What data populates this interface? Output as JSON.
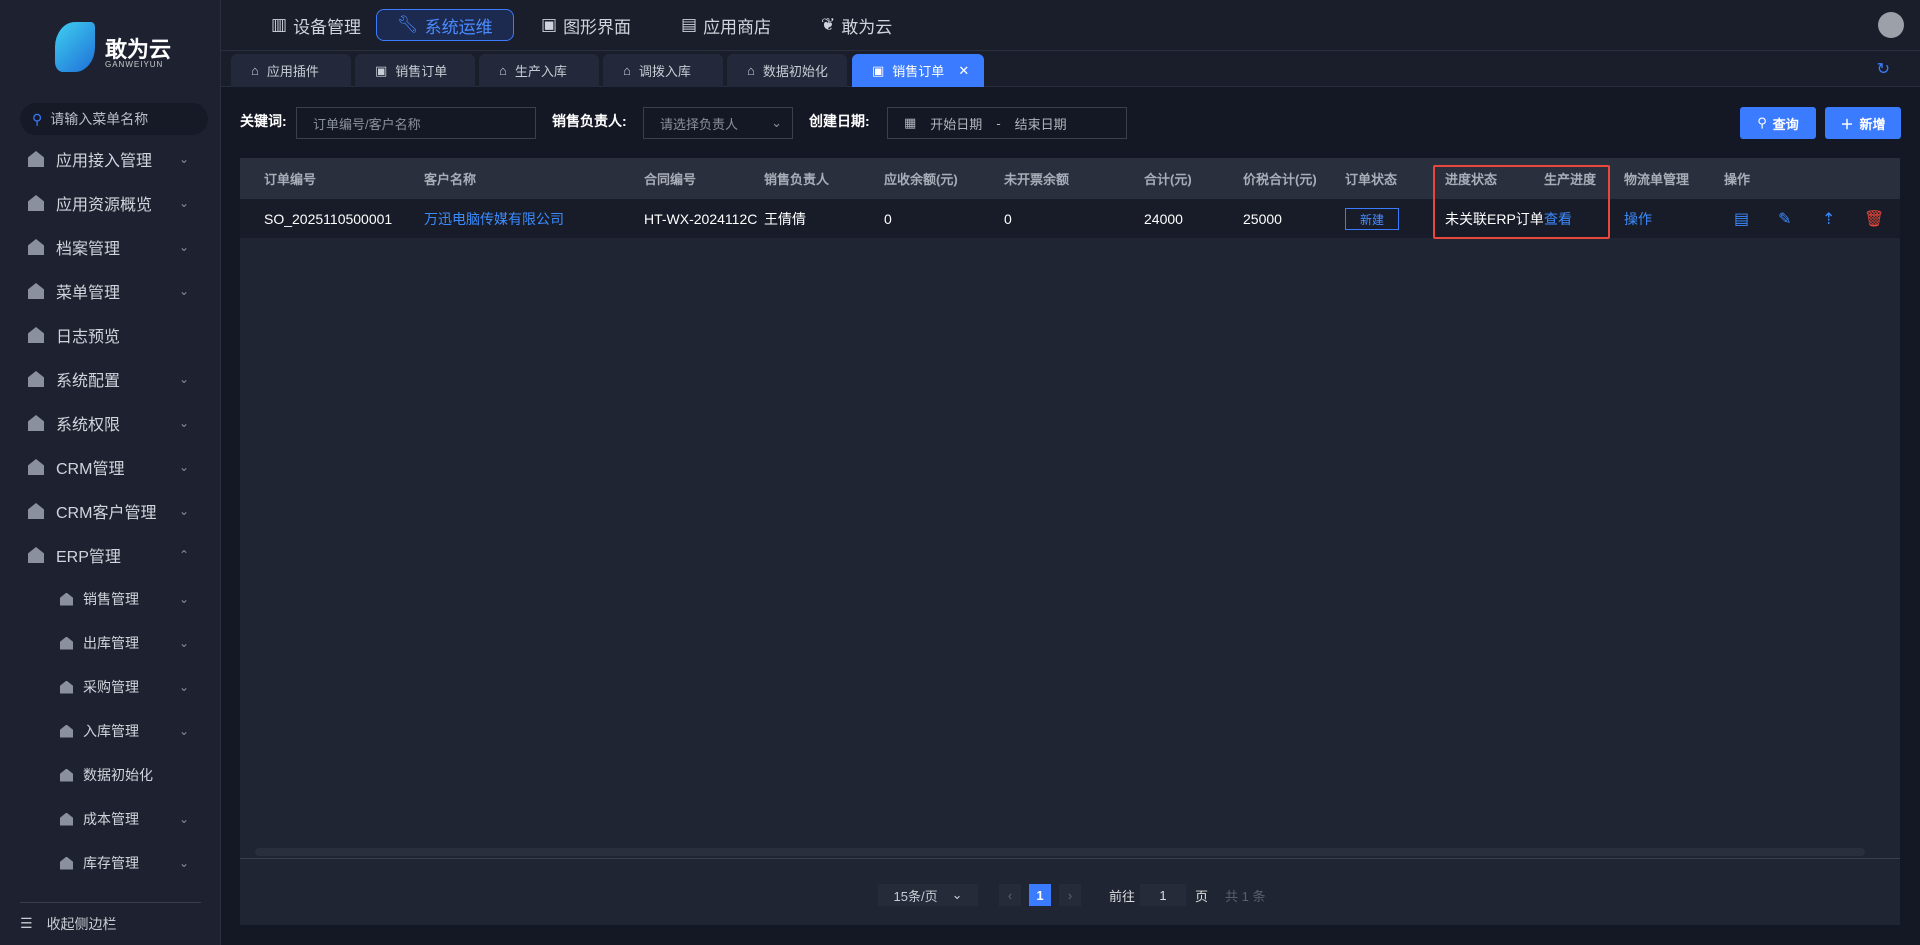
{
  "brand": {
    "name": "敢为云",
    "sub": "GANWEIYUN"
  },
  "sidebar": {
    "search_placeholder": "请输入菜单名称",
    "items": [
      {
        "label": "应用接入管理",
        "chev": "⌄"
      },
      {
        "label": "应用资源概览",
        "chev": "⌄"
      },
      {
        "label": "档案管理",
        "chev": "⌄"
      },
      {
        "label": "菜单管理",
        "chev": "⌄"
      },
      {
        "label": "日志预览",
        "chev": ""
      },
      {
        "label": "系统配置",
        "chev": "⌄"
      },
      {
        "label": "系统权限",
        "chev": "⌄"
      },
      {
        "label": "CRM管理",
        "chev": "⌄"
      },
      {
        "label": "CRM客户管理",
        "chev": "⌄"
      },
      {
        "label": "ERP管理",
        "chev": "⌃"
      }
    ],
    "sub_items": [
      {
        "label": "销售管理",
        "chev": "⌄"
      },
      {
        "label": "出库管理",
        "chev": "⌄"
      },
      {
        "label": "采购管理",
        "chev": "⌄"
      },
      {
        "label": "入库管理",
        "chev": "⌄"
      },
      {
        "label": "数据初始化",
        "chev": ""
      },
      {
        "label": "成本管理",
        "chev": "⌄"
      },
      {
        "label": "库存管理",
        "chev": "⌄"
      }
    ],
    "collapse": "收起侧边栏"
  },
  "topnav": [
    {
      "label": "设备管理"
    },
    {
      "label": "系统运维"
    },
    {
      "label": "图形界面"
    },
    {
      "label": "应用商店"
    },
    {
      "label": "敢为云"
    }
  ],
  "page_tabs": [
    {
      "label": "应用插件"
    },
    {
      "label": "销售订单"
    },
    {
      "label": "生产入库"
    },
    {
      "label": "调拨入库"
    },
    {
      "label": "数据初始化"
    },
    {
      "label": "销售订单"
    }
  ],
  "filters": {
    "keyword_label": "关键词:",
    "keyword_placeholder": "订单编号/客户名称",
    "owner_label": "销售负责人:",
    "owner_placeholder": "请选择负责人",
    "date_label": "创建日期:",
    "start_placeholder": "开始日期",
    "sep": "-",
    "end_placeholder": "结束日期",
    "query": "查询",
    "add": "新增"
  },
  "table": {
    "headers": [
      "订单编号",
      "客户名称",
      "合同编号",
      "销售负责人",
      "应收余额(元)",
      "未开票余额",
      "合计(元)",
      "价税合计(元)",
      "订单状态",
      "进度状态",
      "生产进度",
      "物流单管理",
      "操作"
    ],
    "rows": [
      {
        "order_no": "SO_2025110500001",
        "customer": "万迅电脑传媒有限公司",
        "contract": "HT-WX-2024112C",
        "owner": "王倩倩",
        "receivable": "0",
        "uninvoiced": "0",
        "total": "24000",
        "total_tax": "25000",
        "status": "新建",
        "progress": "未关联ERP订单",
        "production": "查看",
        "logistics": "操作"
      }
    ]
  },
  "pagination": {
    "page_size": "15条/页",
    "current": "1",
    "goto_label": "前往",
    "goto_value": "1",
    "page_suffix": "页",
    "total": "共 1 条"
  },
  "colors": {
    "accent": "#3b7bff",
    "danger": "#e8483c"
  }
}
